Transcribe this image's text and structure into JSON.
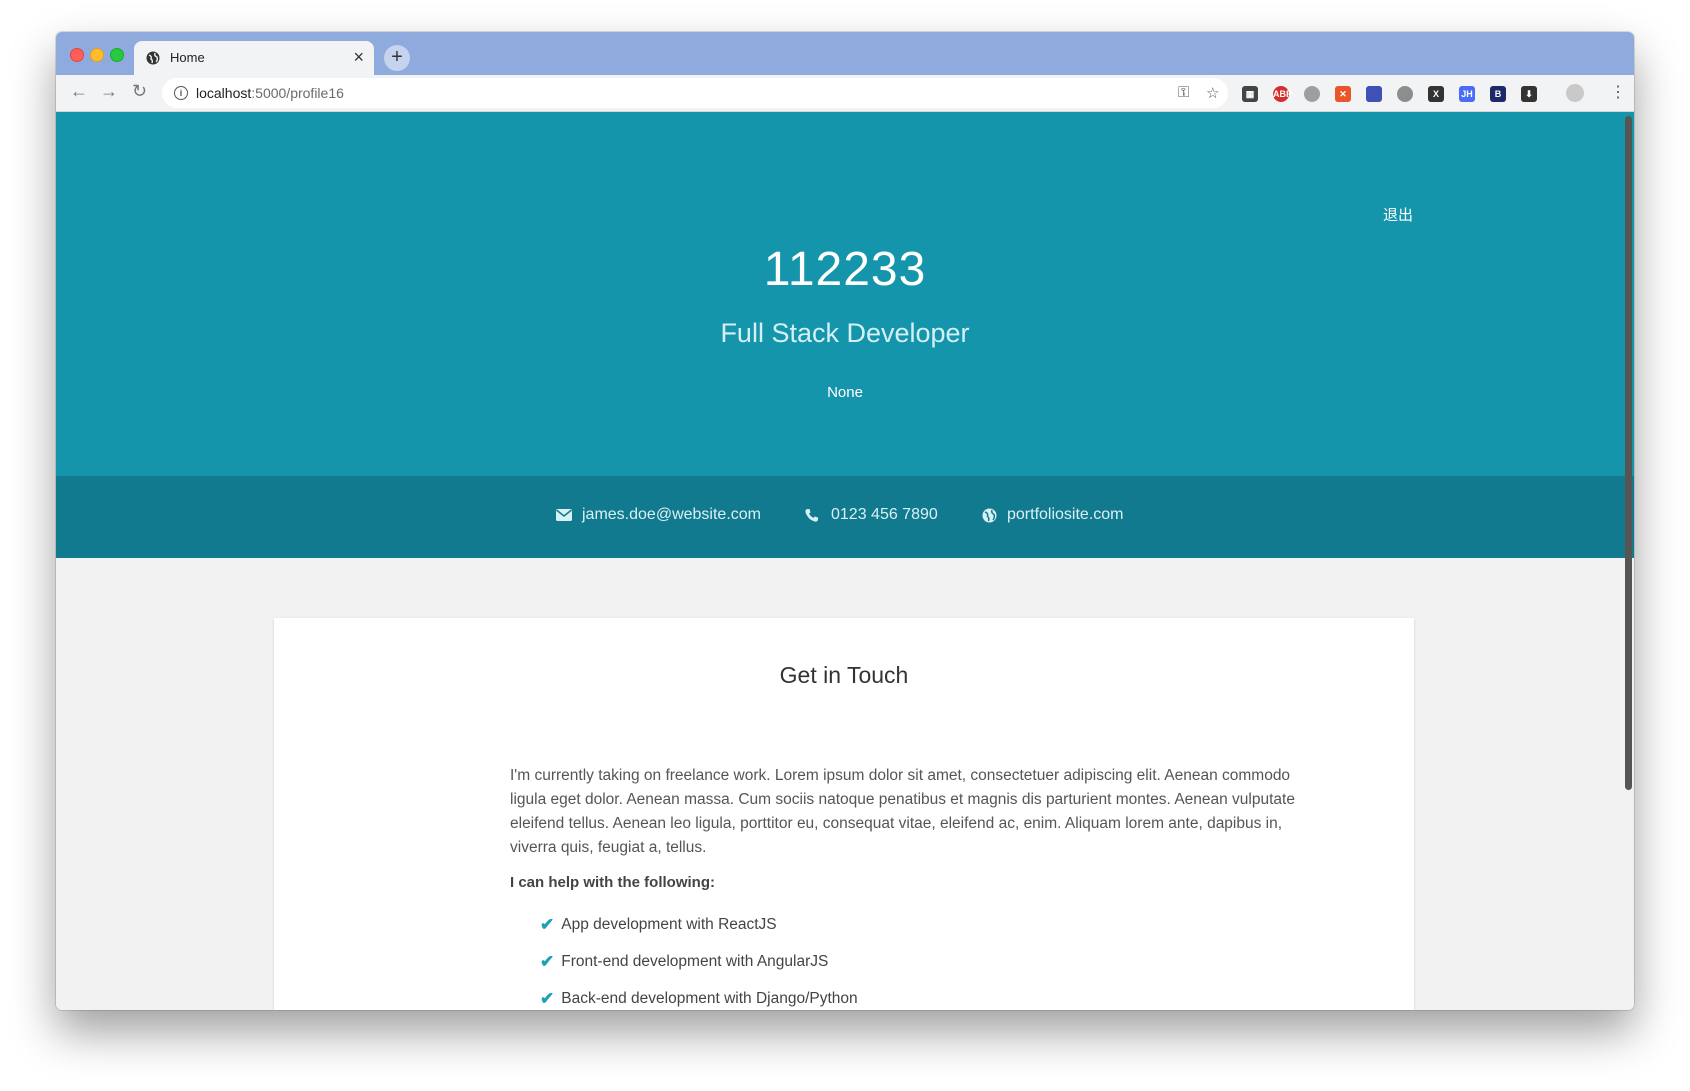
{
  "browser": {
    "tab_title": "Home",
    "tab_close": "×",
    "new_tab": "+",
    "url_host": "localhost",
    "url_path": ":5000/profile16",
    "nav_back": "←",
    "nav_forward": "→",
    "nav_reload": "↻",
    "extensions": [
      {
        "name": "qr-extension-icon",
        "text": "▦",
        "color": "#444444"
      },
      {
        "name": "adblock-extension-icon",
        "text": "ABP",
        "color": "#d32f2f"
      },
      {
        "name": "globe-extension-icon",
        "text": "",
        "color": "#9e9e9e"
      },
      {
        "name": "orange-extension-icon",
        "text": "✕",
        "color": "#e8562a"
      },
      {
        "name": "colorful-extension-icon",
        "text": "",
        "color": "#3f51b5"
      },
      {
        "name": "world-extension-icon",
        "text": "",
        "color": "#8d8d8d"
      },
      {
        "name": "x-extension-icon",
        "text": "X",
        "color": "#333333"
      },
      {
        "name": "jh-extension-icon",
        "text": "JH",
        "color": "#4a6cf7"
      },
      {
        "name": "b-extension-icon",
        "text": "B",
        "color": "#1c2a6b"
      },
      {
        "name": "download-extension-icon",
        "text": "⬇",
        "color": "#333333"
      }
    ]
  },
  "header": {
    "logout": "退出",
    "name": "112233",
    "job": "Full Stack Developer",
    "tagline": "None"
  },
  "contacts": {
    "email": "james.doe@website.com",
    "phone": "0123 456 7890",
    "website": "portfoliosite.com"
  },
  "section": {
    "title": "Get in Touch",
    "intro": "I'm currently taking on freelance work. Lorem ipsum dolor sit amet, consectetuer adipiscing elit. Aenean commodo ligula eget dolor. Aenean massa. Cum sociis natoque penatibus et magnis dis parturient montes. Aenean vulputate eleifend tellus. Aenean leo ligula, porttitor eu, consequat vitae, eleifend ac, enim. Aliquam lorem ante, dapibus in, viverra quis, feugiat a, tellus.",
    "subhead": "I can help with the following:",
    "services": [
      "App development with ReactJS",
      "Front-end development with AngularJS",
      "Back-end development with Django/Python"
    ]
  },
  "colors": {
    "header_bg": "#1595ab",
    "contact_bar_bg": "#127a8f",
    "accent_check": "#1aa1b6"
  }
}
